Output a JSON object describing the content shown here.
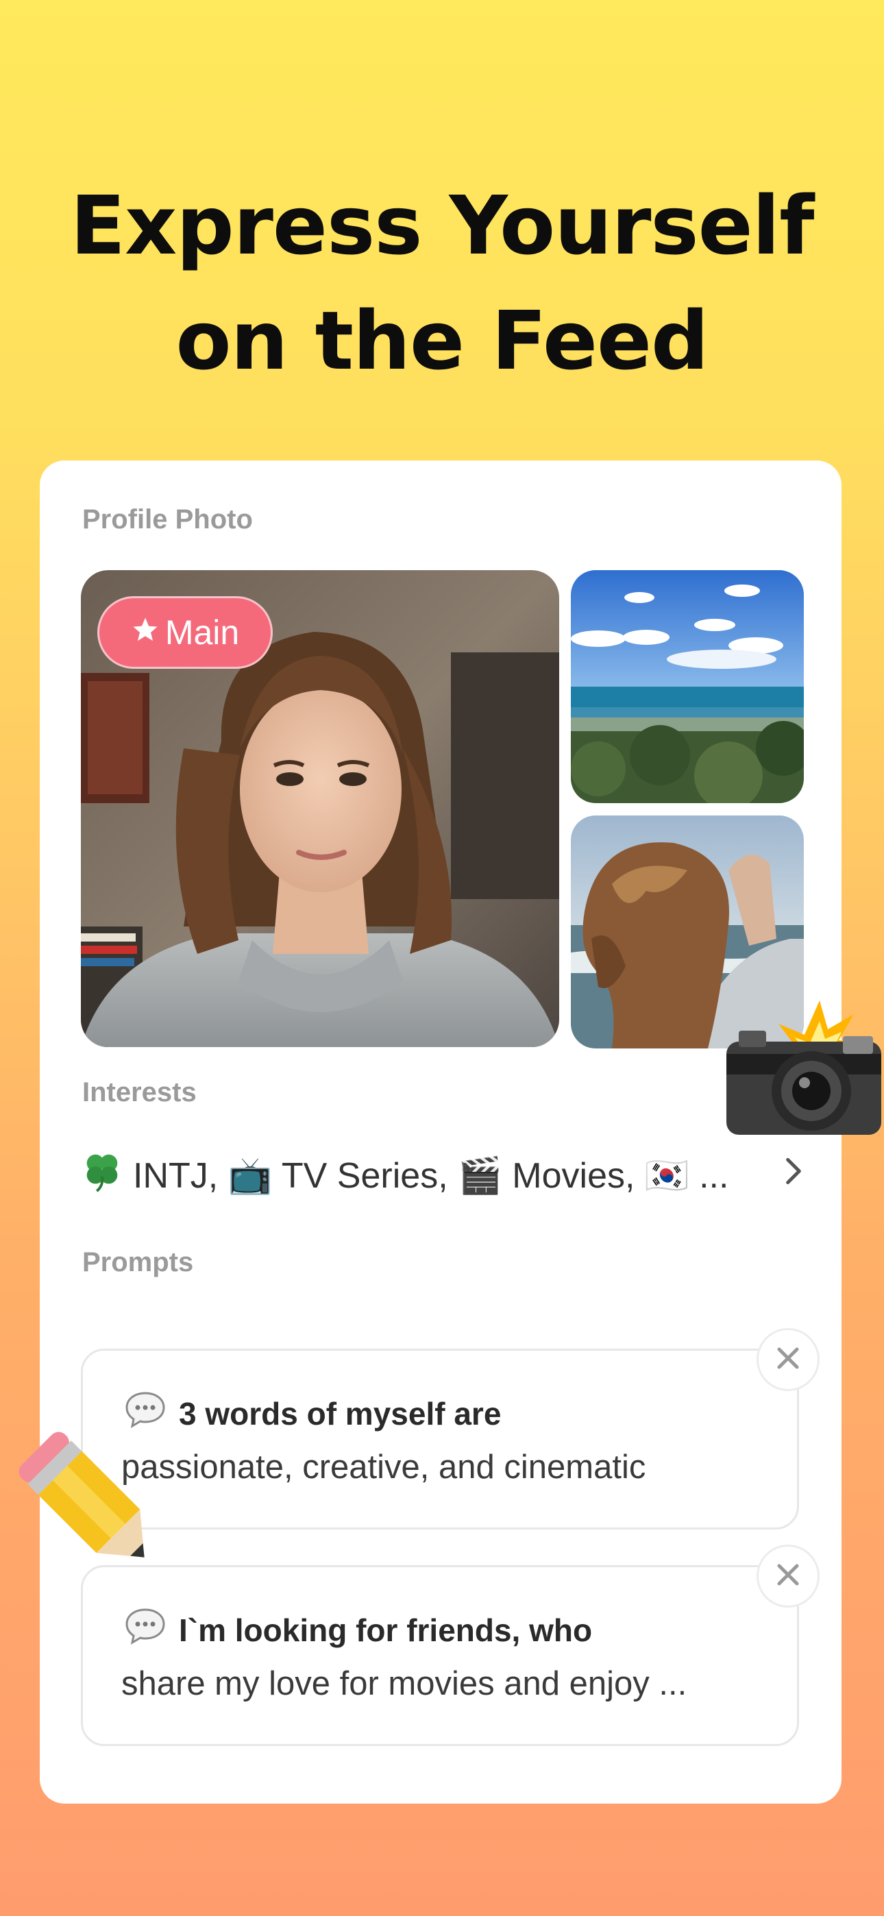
{
  "headline": {
    "line1": "Express Yourself",
    "line2": "on the Feed"
  },
  "profile_photo": {
    "label": "Profile Photo",
    "main_badge": "Main"
  },
  "interests": {
    "label": "Interests",
    "summary": "INTJ, 📺 TV Series, 🎬 Movies, 🇰🇷 ..."
  },
  "prompts": {
    "label": "Prompts",
    "items": [
      {
        "question": "3 words of myself are",
        "answer": "passionate, creative, and cinematic"
      },
      {
        "question": "I`m looking for friends, who",
        "answer": "share my love for movies and enjoy ..."
      }
    ]
  },
  "colors": {
    "gradient_top": "#FFE95C",
    "gradient_bottom": "#FF9C6E",
    "main_badge": "#F46A7A",
    "label_gray": "#9a9a9a"
  },
  "icons": [
    "star-icon",
    "clover-icon",
    "chevron-right-icon",
    "speech-bubble-icon",
    "close-icon",
    "camera-flash-icon",
    "pencil-icon"
  ]
}
